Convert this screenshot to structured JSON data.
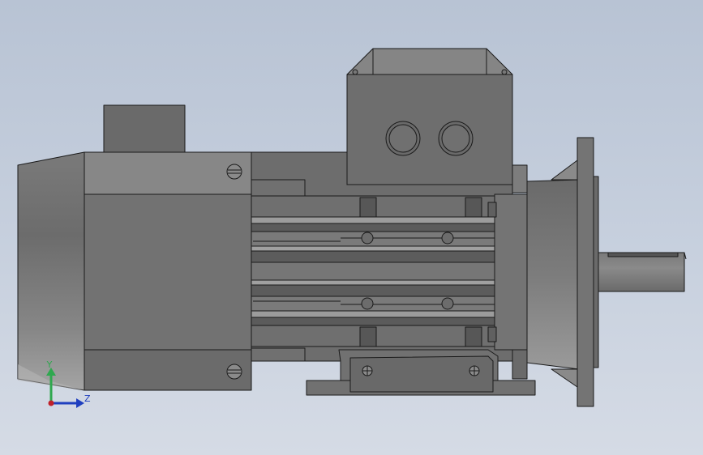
{
  "viewport": {
    "background_top": "#b8c3d4",
    "background_bottom": "#d5dbe5"
  },
  "model": {
    "body_color": "#6f6f6f",
    "dark_color": "#5a5a5a",
    "light_color": "#8e8e8e",
    "line_color": "#1a1a1a"
  },
  "triad": {
    "y_label": "Y",
    "z_label": "Z",
    "y_color": "#2fa84f",
    "z_color": "#1f3fbf",
    "x_color": "#c0202a"
  }
}
